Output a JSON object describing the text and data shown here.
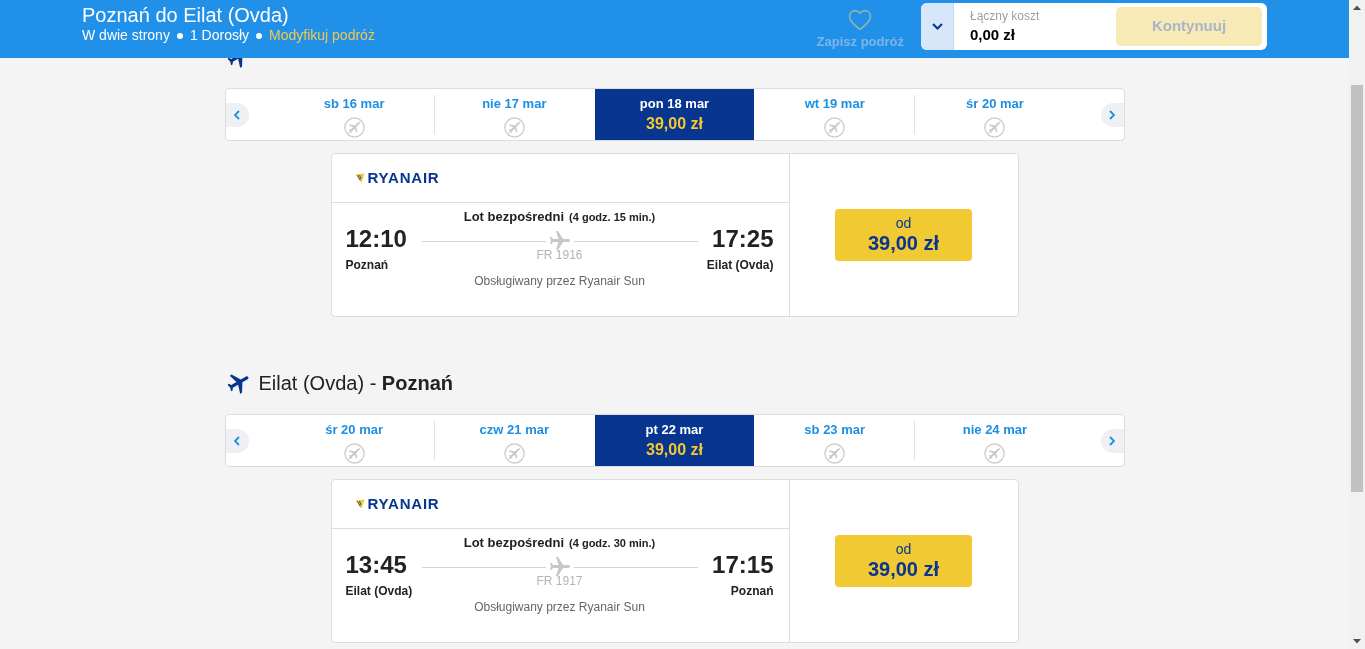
{
  "header": {
    "title": "Poznań do Eilat (Ovda)",
    "trip_type": "W dwie strony",
    "passengers": "1 Dorosły",
    "modify_link": "Modyfikuj podróż"
  },
  "save_trip": {
    "label": "Zapisz podróż",
    "disabled": true
  },
  "cost_summary": {
    "label": "Łączny koszt",
    "value": "0,00 zł"
  },
  "continue_button": {
    "label": "Kontynuuj",
    "disabled": true
  },
  "journeys": [
    {
      "dates": [
        {
          "label": "sb 16 mar",
          "selected": false,
          "available": false
        },
        {
          "label": "nie 17 mar",
          "selected": false,
          "available": false
        },
        {
          "label": "pon 18 mar",
          "selected": true,
          "available": true,
          "price": "39,00 zł"
        },
        {
          "label": "wt 19 mar",
          "selected": false,
          "available": false
        },
        {
          "label": "śr 20 mar",
          "selected": false,
          "available": false
        }
      ],
      "flight": {
        "airline": "RYANAIR",
        "type": "Lot bezpośredni",
        "duration": "(4 godz. 15 min.)",
        "departure_time": "12:10",
        "departure_airport": "Poznań",
        "flight_number": "FR 1916",
        "arrival_time": "17:25",
        "arrival_airport": "Eilat (Ovda)",
        "operator": "Obsługiwany przez Ryanair Sun",
        "fare": {
          "prefix": "od",
          "price": "39,00 zł"
        }
      }
    },
    {
      "title": "Eilat (Ovda) - **Poznań**",
      "dates": [
        {
          "label": "śr 20 mar",
          "selected": false,
          "available": false
        },
        {
          "label": "czw 21 mar",
          "selected": false,
          "available": false
        },
        {
          "label": "pt 22 mar",
          "selected": true,
          "available": true,
          "price": "39,00 zł"
        },
        {
          "label": "sb 23 mar",
          "selected": false,
          "available": false
        },
        {
          "label": "nie 24 mar",
          "selected": false,
          "available": false
        }
      ],
      "flight": {
        "airline": "RYANAIR",
        "type": "Lot bezpośredni",
        "duration": "(4 godz. 30 min.)",
        "departure_time": "13:45",
        "departure_airport": "Eilat (Ovda)",
        "flight_number": "FR 1917",
        "arrival_time": "17:15",
        "arrival_airport": "Poznań",
        "operator": "Obsługiwany przez Ryanair Sun",
        "fare": {
          "prefix": "od",
          "price": "39,00 zł"
        }
      }
    }
  ]
}
